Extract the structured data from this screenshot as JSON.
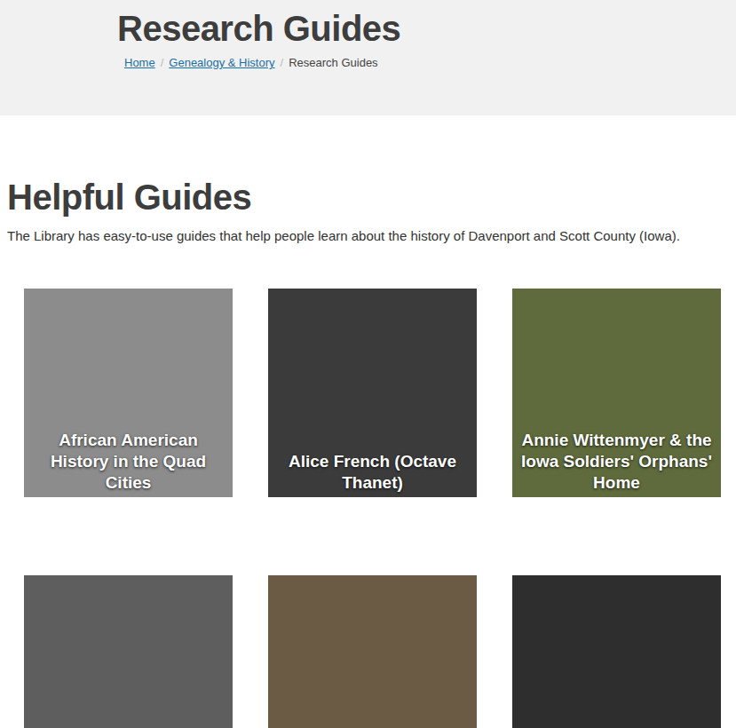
{
  "header": {
    "title": "Research Guides",
    "breadcrumb": [
      {
        "label": "Home",
        "link": true
      },
      {
        "label": "Genealogy & History",
        "link": true
      },
      {
        "label": "Research Guides",
        "link": false
      }
    ],
    "separator": "/"
  },
  "section": {
    "title": "Helpful Guides",
    "description": "The Library has easy-to-use guides that help people learn about the history of Davenport and Scott County (Iowa)."
  },
  "guides": [
    {
      "title": "African American History in the Quad Cities"
    },
    {
      "title": "Alice French (Octave Thanet)"
    },
    {
      "title": "Annie Wittenmyer & the Iowa Soldiers' Orphans' Home"
    },
    {
      "title": ""
    },
    {
      "title": ""
    },
    {
      "title": ""
    }
  ]
}
